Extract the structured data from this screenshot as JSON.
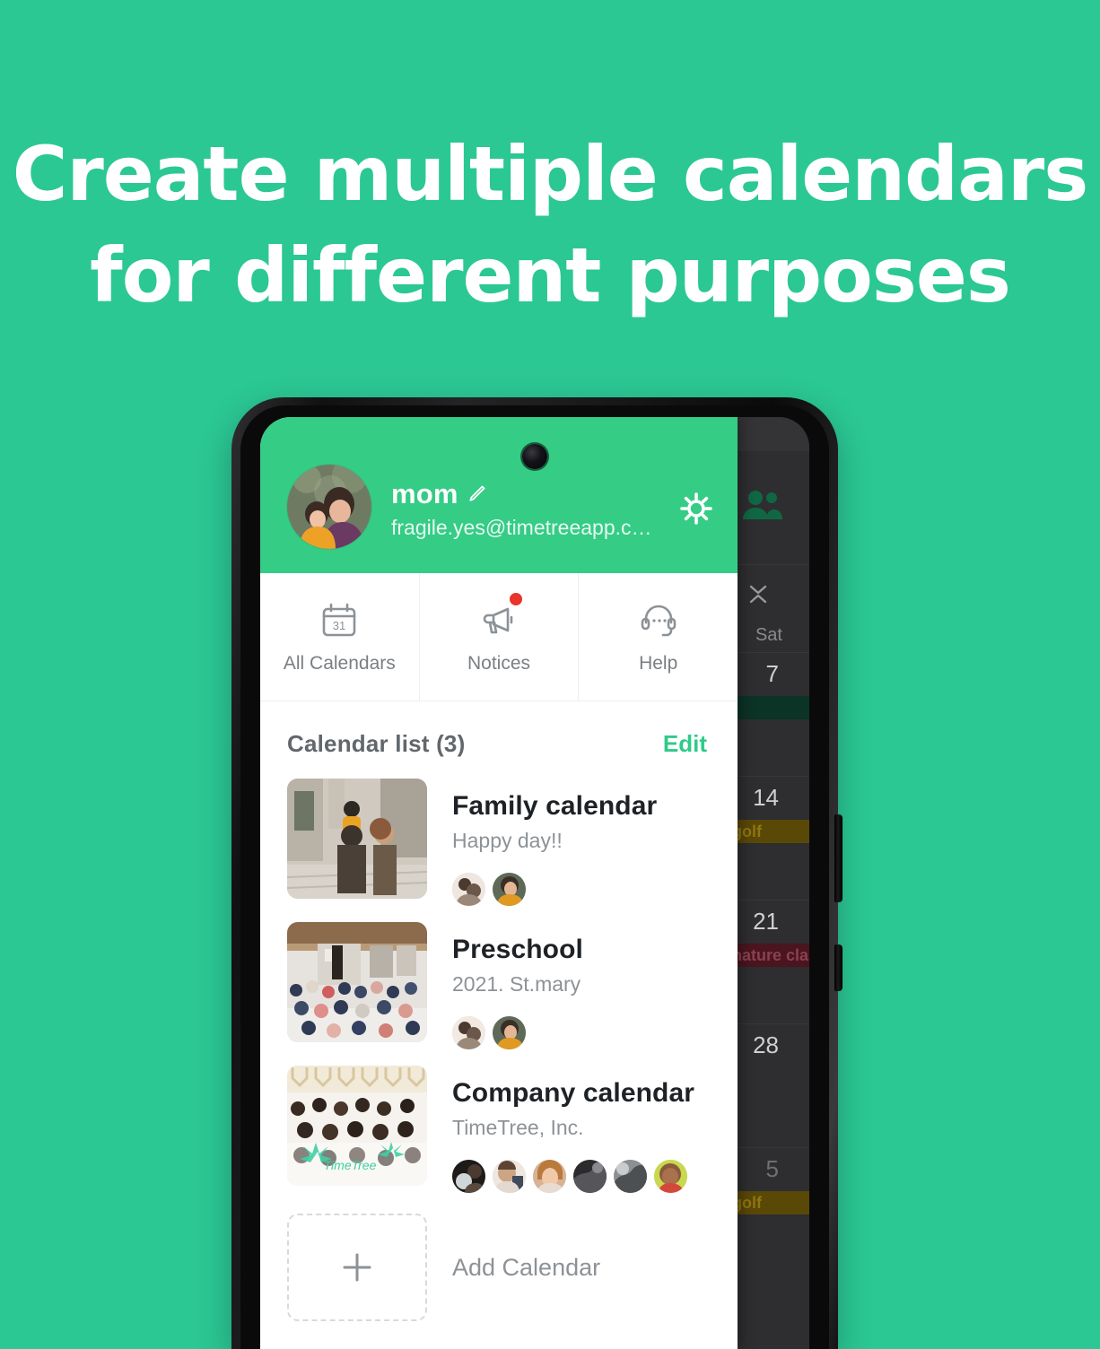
{
  "headline": {
    "line1": "Create multiple calendars",
    "line2": "for different purposes"
  },
  "colors": {
    "background": "#2bc894",
    "header_green": "#35cc86",
    "accent_green": "#2ecb88",
    "badge_red": "#e8342a"
  },
  "drawer": {
    "profile": {
      "name": "mom",
      "email": "fragile.yes@timetreeapp.com",
      "edit_icon": "pencil-icon",
      "settings_icon": "gear-icon",
      "avatar_alt": "mother and child"
    },
    "tabs": [
      {
        "label": "All Calendars",
        "icon": "calendar-31-icon",
        "badge": false
      },
      {
        "label": "Notices",
        "icon": "megaphone-icon",
        "badge": true
      },
      {
        "label": "Help",
        "icon": "headset-icon",
        "badge": false
      }
    ],
    "list_header": {
      "title": "Calendar list (3)",
      "edit_label": "Edit"
    },
    "calendars": [
      {
        "name": "Family calendar",
        "note": "Happy day!!",
        "thumb_alt": "family walking on a street",
        "member_count": 2
      },
      {
        "name": "Preschool",
        "note": "2021. St.mary",
        "thumb_alt": "large group photo in a gymnasium",
        "member_count": 2
      },
      {
        "name": "Company calendar",
        "note": "TimeTree, Inc.",
        "thumb_alt": "company group photo with TimeTree banner",
        "member_count": 6
      }
    ],
    "add_calendar": {
      "label": "Add Calendar",
      "icon": "plus-icon"
    }
  },
  "background_calendar": {
    "members_icon": "people-icon",
    "collapse_icon": "chevron-collapse-icon",
    "weekday": "Sat",
    "days": [
      {
        "number": "7",
        "event": "",
        "event_color": "green",
        "dim": false
      },
      {
        "number": "14",
        "event": "golf",
        "event_color": "yellow",
        "dim": false
      },
      {
        "number": "21",
        "event": "nature cla",
        "event_color": "red",
        "dim": false
      },
      {
        "number": "28",
        "event": "",
        "event_color": "",
        "dim": false
      },
      {
        "number": "5",
        "event": "golf",
        "event_color": "yellow",
        "dim": true
      }
    ]
  }
}
